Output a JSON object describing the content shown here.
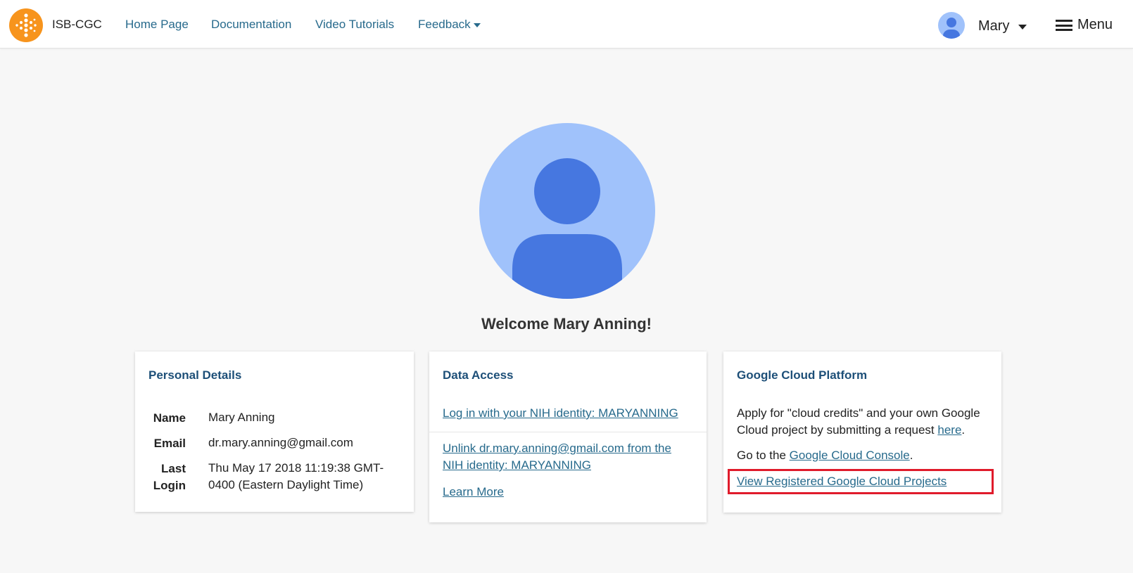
{
  "navbar": {
    "brand": "ISB-CGC",
    "links": {
      "home": "Home Page",
      "documentation": "Documentation",
      "tutorials": "Video Tutorials",
      "feedback": "Feedback"
    },
    "user": "Mary",
    "menu": "Menu"
  },
  "welcome": "Welcome Mary Anning!",
  "personal_details": {
    "title": "Personal Details",
    "name_label": "Name",
    "name": "Mary Anning",
    "email_label": "Email",
    "email": "dr.mary.anning@gmail.com",
    "last_label_1": "Last",
    "last_label_2": "Login",
    "last_login_1": "Thu May 17 2018 11:19:38 GMT-",
    "last_login_2": "0400 (Eastern Daylight Time)"
  },
  "data_access": {
    "title": "Data Access",
    "login_link": "Log in with your NIH identity: MARYANNING",
    "unlink_1": "Unlink dr.mary.anning@gmail.com from the",
    "unlink_2": "NIH identity: MARYANNING",
    "learn_more": "Learn More"
  },
  "gcp": {
    "title": "Google Cloud Platform",
    "apply_1": "Apply for \"cloud credits\" and your own Google",
    "apply_2": "Cloud project by submitting a request ",
    "here": "here",
    "period": ".",
    "goto": "Go to the ",
    "console": "Google Cloud Console",
    "view_projects": "View Registered Google Cloud Projects"
  },
  "colors": {
    "accent_orange": "#f7941d",
    "link": "#276a8c",
    "title": "#1d4f78",
    "avatar_light": "#a0c2fb",
    "avatar_dark": "#4677e0",
    "highlight": "#e01b2b"
  },
  "icons": {
    "logo": "isb-cgc-logo",
    "avatar": "user-avatar-icon",
    "menu": "hamburger-icon",
    "dropdown": "caret-down-icon"
  }
}
